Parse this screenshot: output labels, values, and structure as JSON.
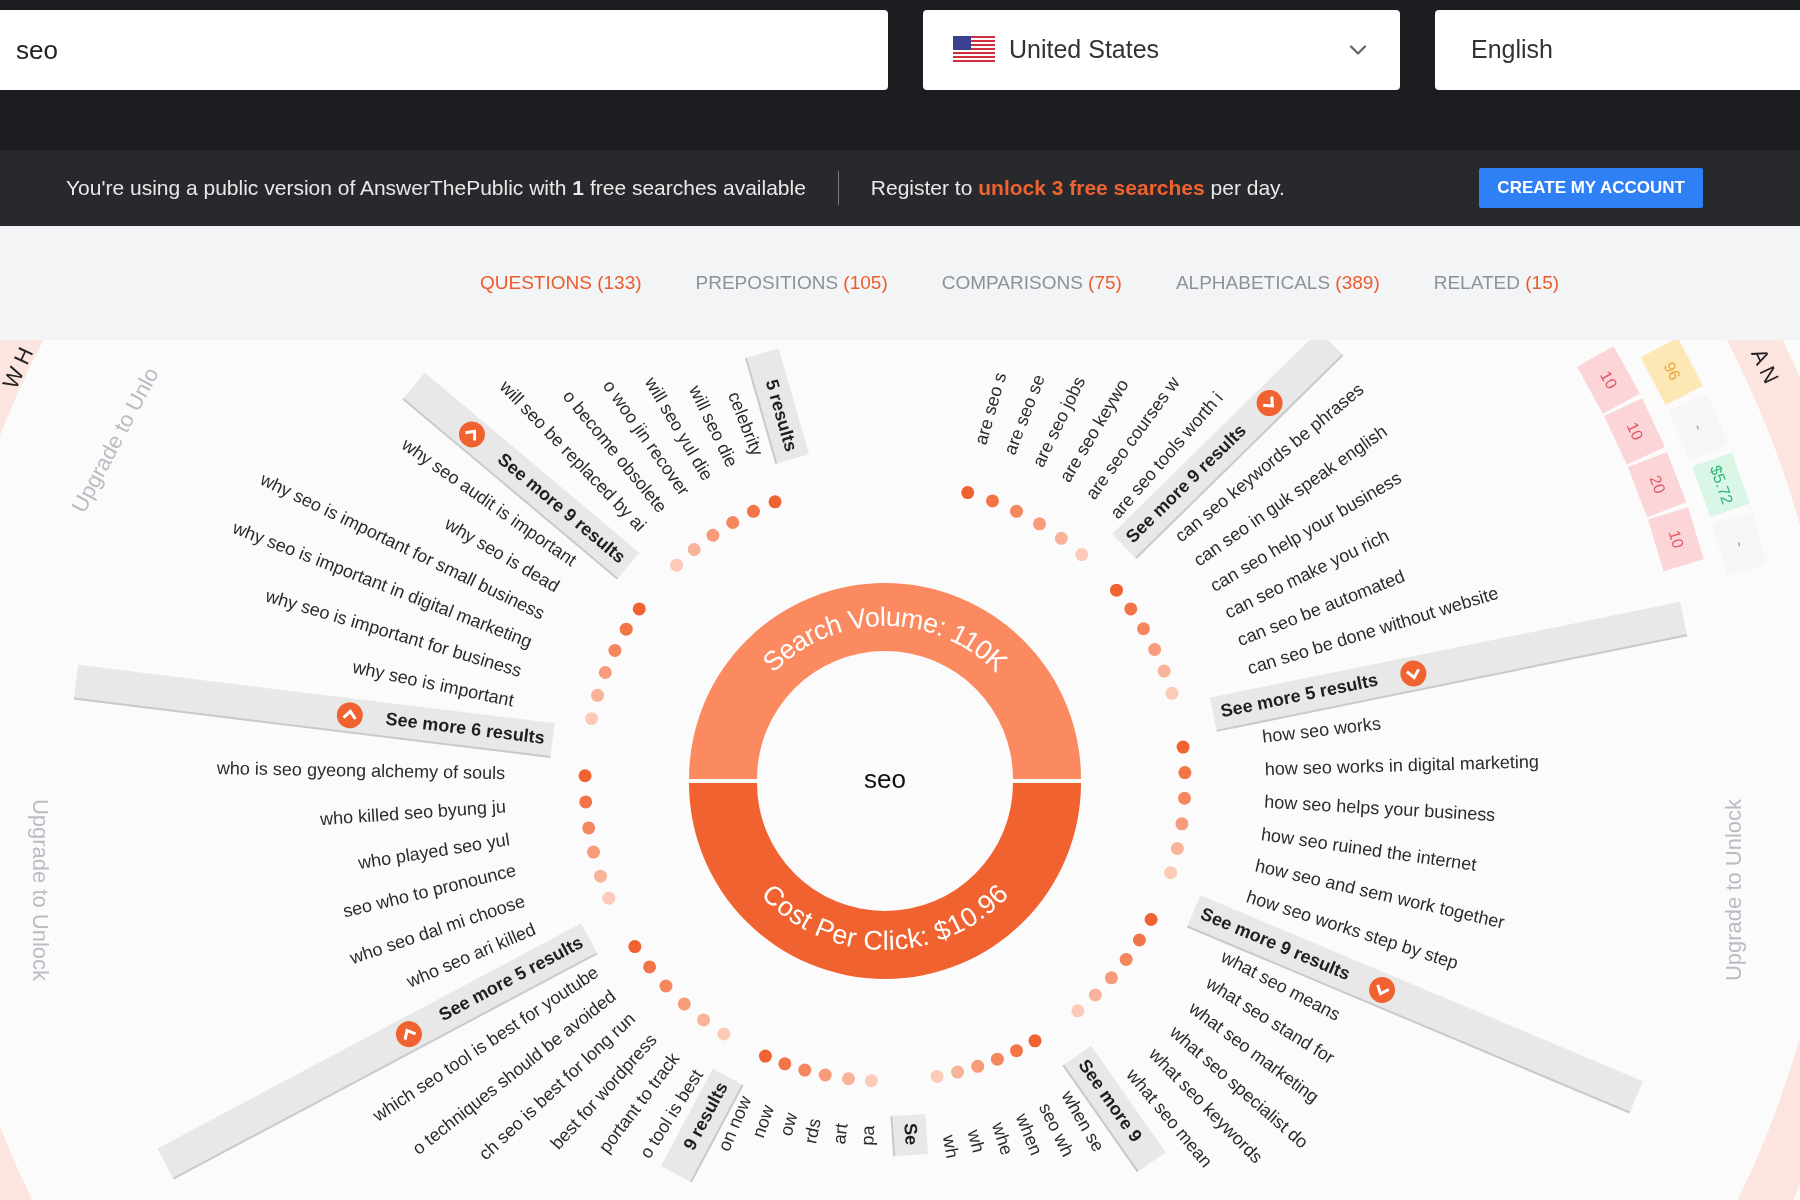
{
  "search": {
    "value": "seo"
  },
  "country": {
    "value": "United States"
  },
  "language": {
    "value": "English"
  },
  "banner": {
    "text": "You're using a public version of AnswerThePublic with **1** free searches available",
    "register_prefix": "Register to",
    "register_link": "unlock 3 free searches",
    "register_suffix": "per day.",
    "button": "CREATE MY ACCOUNT"
  },
  "tabs": [
    {
      "label": "QUESTIONS",
      "count": "(133)",
      "selected": true
    },
    {
      "label": "PREPOSITIONS",
      "count": "(105)",
      "selected": false
    },
    {
      "label": "COMPARISONS",
      "count": "(75)",
      "selected": false
    },
    {
      "label": "ALPHABETICALS",
      "count": "(389)",
      "selected": false
    },
    {
      "label": "RELATED",
      "count": "(15)",
      "selected": false
    }
  ],
  "wheel": {
    "keyword": "seo",
    "volume_label": "Search Volume: 110K",
    "cpc_label": "Cost Per Click: $10.96",
    "entries": [
      {
        "kind": "more",
        "text": "5 results",
        "chevron": false
      },
      {
        "kind": "query",
        "text": "celebrity"
      },
      {
        "kind": "query",
        "text": "will seo die"
      },
      {
        "kind": "query",
        "text": "will seo yul die"
      },
      {
        "kind": "query",
        "text": "o woo jin recover"
      },
      {
        "kind": "query",
        "text": "o become obsolete"
      },
      {
        "kind": "query",
        "text": "will seo be replaced by ai"
      },
      {
        "kind": "more",
        "text": "See more 9 results",
        "chevron": true
      },
      {
        "kind": "query",
        "text": "why seo audit is important"
      },
      {
        "kind": "query",
        "text": "why seo is dead"
      },
      {
        "kind": "query",
        "text": "why seo is important for small business"
      },
      {
        "kind": "query",
        "text": "why seo is important in digital marketing"
      },
      {
        "kind": "query",
        "text": "why seo is important for business"
      },
      {
        "kind": "query",
        "text": "why seo is important"
      },
      {
        "kind": "more",
        "text": "See more 6 results",
        "chevron": true
      },
      {
        "kind": "query",
        "text": "who is seo gyeong alchemy of souls"
      },
      {
        "kind": "query",
        "text": "who killed seo byung ju"
      },
      {
        "kind": "query",
        "text": "who played seo yul"
      },
      {
        "kind": "query",
        "text": "seo who to pronounce"
      },
      {
        "kind": "query",
        "text": "who seo dal mi choose"
      },
      {
        "kind": "query",
        "text": "who seo ari killed"
      },
      {
        "kind": "more",
        "text": "See more 5 results",
        "chevron": true
      },
      {
        "kind": "query",
        "text": "which seo tool is best for youtube"
      },
      {
        "kind": "query",
        "text": "o techniques should be avoided"
      },
      {
        "kind": "query",
        "text": "ch seo is best for long run"
      },
      {
        "kind": "query",
        "text": "best for wordpress"
      },
      {
        "kind": "query",
        "text": "portant to track"
      },
      {
        "kind": "query",
        "text": "o tool is best"
      },
      {
        "kind": "more",
        "text": "9 results",
        "chevron": false
      },
      {
        "kind": "query",
        "text": "on now"
      },
      {
        "kind": "query",
        "text": "now"
      },
      {
        "kind": "query",
        "text": "ow"
      },
      {
        "kind": "query",
        "text": "rds"
      },
      {
        "kind": "query",
        "text": "art"
      },
      {
        "kind": "query",
        "text": "pa"
      },
      {
        "kind": "query",
        "text": "are seo s"
      },
      {
        "kind": "query",
        "text": "are seo se"
      },
      {
        "kind": "query",
        "text": "are seo jobs"
      },
      {
        "kind": "query",
        "text": "are seo keywo"
      },
      {
        "kind": "query",
        "text": "are seo courses w"
      },
      {
        "kind": "query",
        "text": "are seo tools worth i"
      },
      {
        "kind": "more",
        "text": "See more 9 results",
        "chevron": true
      },
      {
        "kind": "query",
        "text": "can seo keywords be phrases"
      },
      {
        "kind": "query",
        "text": "can seo in guk speak english"
      },
      {
        "kind": "query",
        "text": "can seo help your business"
      },
      {
        "kind": "query",
        "text": "can seo make you rich"
      },
      {
        "kind": "query",
        "text": "can seo be automated"
      },
      {
        "kind": "query",
        "text": "can seo be done without website"
      },
      {
        "kind": "more",
        "text": "See more 5 results",
        "chevron": true
      },
      {
        "kind": "query",
        "text": "how seo works"
      },
      {
        "kind": "query",
        "text": "how seo works in digital marketing"
      },
      {
        "kind": "query",
        "text": "how seo helps your business"
      },
      {
        "kind": "query",
        "text": "how seo ruined the internet"
      },
      {
        "kind": "query",
        "text": "how seo and sem work together"
      },
      {
        "kind": "query",
        "text": "how seo works step by step"
      },
      {
        "kind": "more",
        "text": "See more 9 results",
        "chevron": true
      },
      {
        "kind": "query",
        "text": "what seo means"
      },
      {
        "kind": "query",
        "text": "what seo stand for"
      },
      {
        "kind": "query",
        "text": "what seo marketing"
      },
      {
        "kind": "query",
        "text": "what seo specialist do"
      },
      {
        "kind": "query",
        "text": "what seo keywords"
      },
      {
        "kind": "query",
        "text": "what seo mean"
      },
      {
        "kind": "more",
        "text": "See more 9",
        "chevron": false
      },
      {
        "kind": "query",
        "text": "when se"
      },
      {
        "kind": "query",
        "text": "seo wh"
      },
      {
        "kind": "query",
        "text": "when"
      },
      {
        "kind": "query",
        "text": "whe"
      },
      {
        "kind": "query",
        "text": "wh"
      },
      {
        "kind": "query",
        "text": "wh"
      },
      {
        "kind": "more",
        "text": "Se",
        "chevron": false
      }
    ],
    "metrics": [
      {
        "kind": "volume",
        "text": "10"
      },
      {
        "kind": "volume",
        "text": "10"
      },
      {
        "kind": "volume",
        "text": "20"
      },
      {
        "kind": "volume",
        "text": "10"
      },
      {
        "kind": "partial",
        "text": "96"
      },
      {
        "kind": "empty",
        "text": "-"
      },
      {
        "kind": "cpc",
        "text": "$5.72"
      },
      {
        "kind": "empty",
        "text": "-"
      }
    ],
    "locked_labels": [
      "Upgrade to Unlo",
      "Upgrade to Unlock",
      "Upgrade to Unlock"
    ],
    "ring_letters": [
      "W H",
      "A N"
    ]
  }
}
